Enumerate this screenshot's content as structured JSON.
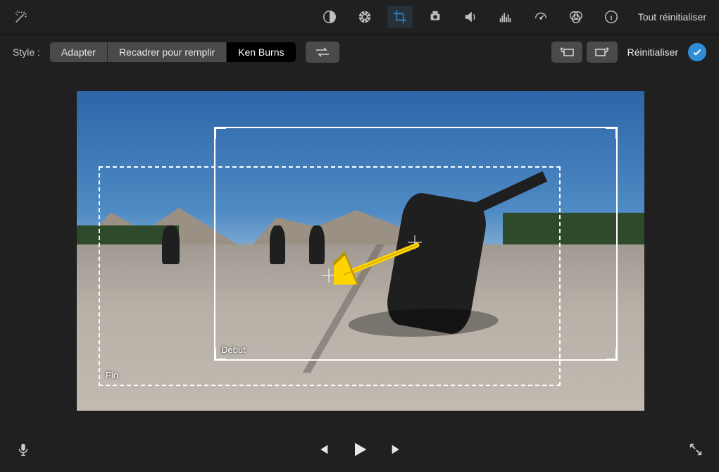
{
  "iconbar": {
    "reset_all": "Tout réinitialiser",
    "icons": {
      "wand": "auto-enhance-icon",
      "balance": "color-balance-icon",
      "palette": "color-correction-icon",
      "crop": "crop-icon",
      "camera": "stabilization-icon",
      "volume": "volume-icon",
      "eq": "noise-eq-icon",
      "speed": "speed-icon",
      "filters": "filters-icon",
      "info": "info-icon"
    }
  },
  "stylebar": {
    "label": "Style :",
    "options": [
      "Adapter",
      "Recadrer pour remplir",
      "Ken Burns"
    ],
    "selected": "Ken Burns",
    "reset": "Réinitialiser"
  },
  "viewer": {
    "start_label": "Début",
    "end_label": "Fin"
  },
  "colors": {
    "accent": "#2f8fd6"
  }
}
